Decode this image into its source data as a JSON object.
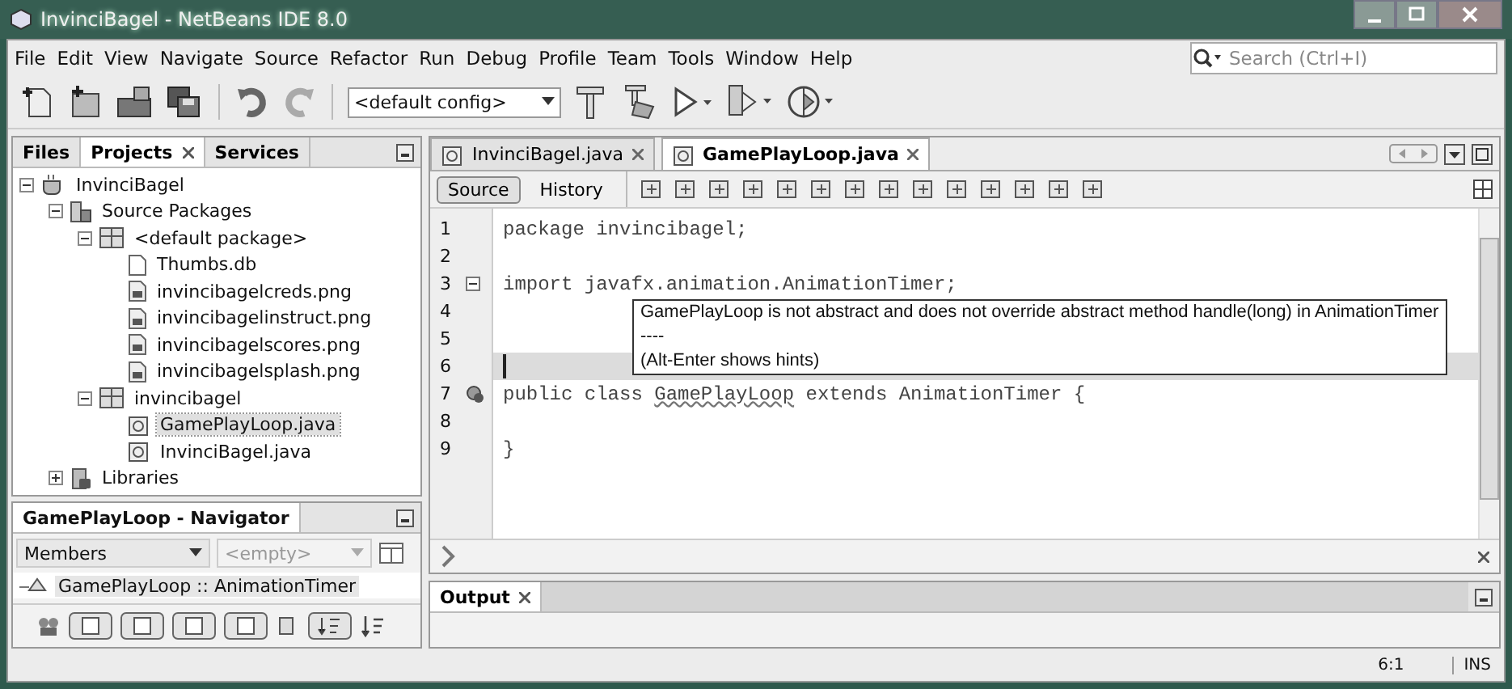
{
  "window": {
    "title": "InvinciBagel - NetBeans IDE 8.0"
  },
  "menu": [
    "File",
    "Edit",
    "View",
    "Navigate",
    "Source",
    "Refactor",
    "Run",
    "Debug",
    "Profile",
    "Team",
    "Tools",
    "Window",
    "Help"
  ],
  "search": {
    "placeholder": "Search (Ctrl+I)"
  },
  "toolbar": {
    "config": "<default config>"
  },
  "left_tabs": [
    {
      "label": "Files",
      "selected": false
    },
    {
      "label": "Projects",
      "selected": true
    },
    {
      "label": "Services",
      "selected": false
    }
  ],
  "tree": [
    {
      "label": "InvinciBagel",
      "kind": "project",
      "expanded": true,
      "selected": false,
      "children": [
        {
          "label": "Source Packages",
          "kind": "sources",
          "expanded": true,
          "selected": false,
          "children": [
            {
              "label": "<default package>",
              "kind": "package",
              "expanded": true,
              "selected": false,
              "children": [
                {
                  "label": "Thumbs.db",
                  "kind": "file",
                  "selected": false
                },
                {
                  "label": "invincibagelcreds.png",
                  "kind": "image",
                  "selected": false
                },
                {
                  "label": "invincibagelinstruct.png",
                  "kind": "image",
                  "selected": false
                },
                {
                  "label": "invincibagelscores.png",
                  "kind": "image",
                  "selected": false
                },
                {
                  "label": "invincibagelsplash.png",
                  "kind": "image",
                  "selected": false
                }
              ]
            },
            {
              "label": "invincibagel",
              "kind": "package",
              "expanded": true,
              "selected": false,
              "children": [
                {
                  "label": "GamePlayLoop.java",
                  "kind": "java",
                  "selected": true
                },
                {
                  "label": "InvinciBagel.java",
                  "kind": "java",
                  "selected": false
                }
              ]
            }
          ]
        },
        {
          "label": "Libraries",
          "kind": "libraries",
          "expanded": false,
          "selected": false
        }
      ]
    }
  ],
  "navigator": {
    "title": "GamePlayLoop - Navigator",
    "filter": "Members",
    "scope": "<empty>",
    "item": "GamePlayLoop :: AnimationTimer"
  },
  "editor_tabs": [
    {
      "label": "InvinciBagel.java",
      "selected": false
    },
    {
      "label": "GamePlayLoop.java",
      "selected": true
    }
  ],
  "view_buttons": [
    {
      "label": "Source",
      "selected": true
    },
    {
      "label": "History",
      "selected": false
    }
  ],
  "code": [
    {
      "number": "1",
      "text": "package invincibagel;",
      "fold": false,
      "current": false
    },
    {
      "number": "2",
      "fold": false,
      "current": false
    },
    {
      "number": "3",
      "text": "import javafx.animation.AnimationTimer;",
      "fold": true,
      "current": false
    },
    {
      "number": "4",
      "fold": false,
      "current": false
    },
    {
      "number": "5",
      "fold": false,
      "current": false
    },
    {
      "number": "6",
      "fold": false,
      "current": true
    },
    {
      "number": "7",
      "text": "public class ",
      "error_text": "GamePlayLoop",
      "text_after": " extends AnimationTimer {",
      "fold": false,
      "current": false
    },
    {
      "number": "8",
      "fold": false,
      "current": false
    },
    {
      "number": "9",
      "text": "}",
      "fold": false,
      "current": false
    }
  ],
  "tooltip": [
    "GamePlayLoop is not abstract and does not override abstract method handle(long) in AnimationTimer",
    "----",
    "(Alt-Enter shows hints)"
  ],
  "output": {
    "tab": "Output"
  },
  "status_bar": {
    "position": "6:1",
    "mode": "INS"
  }
}
